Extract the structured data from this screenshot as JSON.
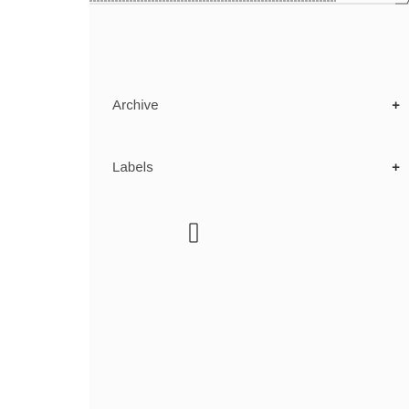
{
  "sections": [
    {
      "label": "Archive",
      "action_label": "+"
    },
    {
      "label": "Labels",
      "action_label": "+"
    }
  ],
  "icons": {
    "add": "plus-icon",
    "cursor": "text-cursor-icon"
  }
}
